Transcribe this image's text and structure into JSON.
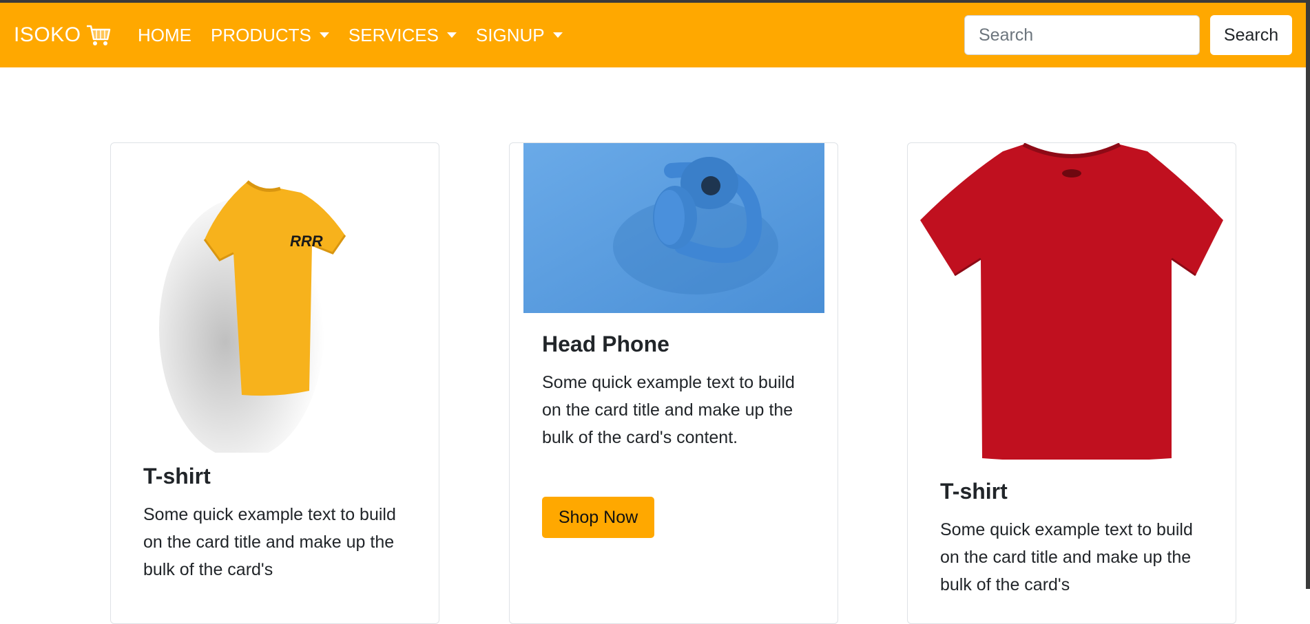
{
  "navbar": {
    "brand": "ISOKO",
    "brand_icon": "cart-icon",
    "links": [
      {
        "label": "HOME",
        "dropdown": false
      },
      {
        "label": "PRODUCTS",
        "dropdown": true
      },
      {
        "label": "SERVICES",
        "dropdown": true
      },
      {
        "label": "SIGNUP",
        "dropdown": true
      }
    ],
    "search_placeholder": "Search",
    "search_value": "",
    "search_button": "Search",
    "color": "#ffa800"
  },
  "cards": [
    {
      "image": "yellow-tshirt-image",
      "title": "T-shirt",
      "text": "Some quick example text to build on the card title and make up the bulk of the card's"
    },
    {
      "image": "blue-headphones-image",
      "title": "Head Phone",
      "text": "Some quick example text to build on the card title and make up the bulk of the card's content.",
      "button": "Shop Now"
    },
    {
      "image": "red-tshirt-image",
      "title": "T-shirt",
      "text": "Some quick example text to build on the card title and make up the bulk of the card's"
    }
  ],
  "colors": {
    "accent": "#ffa800",
    "shirt_yellow": "#f7b21c",
    "shirt_red": "#c0101f",
    "headphone_bg": "#5a9ee0"
  }
}
